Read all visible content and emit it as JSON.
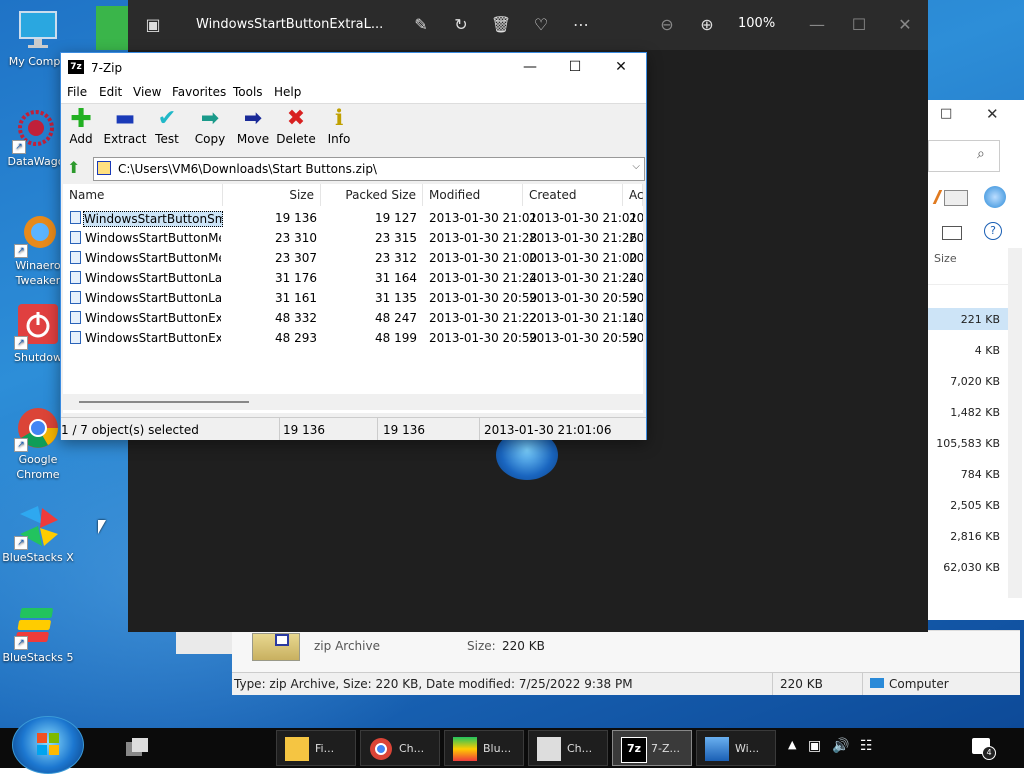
{
  "desktop_icons": [
    {
      "name": "my-computer",
      "label": "My Compu"
    },
    {
      "name": "datawagon",
      "label": "DataWago"
    },
    {
      "name": "winaero-tweaker",
      "label": "Winaero Tweaker"
    },
    {
      "name": "shutdown",
      "label": "Shutdow"
    },
    {
      "name": "google-chrome",
      "label": "Google Chrome"
    },
    {
      "name": "bluestacks-x",
      "label": "BlueStacks X"
    },
    {
      "name": "bluestacks-5",
      "label": "BlueStacks 5"
    }
  ],
  "photos": {
    "title": "WindowsStartButtonExtraL...",
    "zoom": "100%"
  },
  "explorer": {
    "size_header": "Size",
    "sizes": [
      "221 KB",
      "4 KB",
      "7,020 KB",
      "1,482 KB",
      "105,583 KB",
      "784 KB",
      "2,505 KB",
      "2,816 KB",
      "62,030 KB"
    ],
    "detail_type": "zip Archive",
    "detail_size_label": "Size:",
    "detail_size_value": "220 KB",
    "status_text": "Type: zip Archive, Size: 220 KB, Date modified: 7/25/2022 9:38 PM",
    "status_size": "220 KB",
    "status_location": "Computer"
  },
  "sevenzip": {
    "title": "7-Zip",
    "icon_text": "7z",
    "menu": [
      "File",
      "Edit",
      "View",
      "Favorites",
      "Tools",
      "Help"
    ],
    "toolbar": [
      "Add",
      "Extract",
      "Test",
      "Copy",
      "Move",
      "Delete",
      "Info"
    ],
    "address": "C:\\Users\\VM6\\Downloads\\Start Buttons.zip\\",
    "columns": [
      "Name",
      "Size",
      "Packed Size",
      "Modified",
      "Created",
      "Ac"
    ],
    "rows": [
      {
        "name": "WindowsStartButtonSm...",
        "size": "19 136",
        "packed": "19 127",
        "modified": "2013-01-30 21:01",
        "created": "2013-01-30 21:01",
        "ac": "20"
      },
      {
        "name": "WindowsStartButtonMe...",
        "size": "23 310",
        "packed": "23 315",
        "modified": "2013-01-30 21:28",
        "created": "2013-01-30 21:26",
        "ac": "20"
      },
      {
        "name": "WindowsStartButtonMe...",
        "size": "23 307",
        "packed": "23 312",
        "modified": "2013-01-30 21:00",
        "created": "2013-01-30 21:00",
        "ac": "20"
      },
      {
        "name": "WindowsStartButtonLar...",
        "size": "31 176",
        "packed": "31 164",
        "modified": "2013-01-30 21:24",
        "created": "2013-01-30 21:24",
        "ac": "20"
      },
      {
        "name": "WindowsStartButtonLar...",
        "size": "31 161",
        "packed": "31 135",
        "modified": "2013-01-30 20:59",
        "created": "2013-01-30 20:59",
        "ac": "20"
      },
      {
        "name": "WindowsStartButtonExt...",
        "size": "48 332",
        "packed": "48 247",
        "modified": "2013-01-30 21:22",
        "created": "2013-01-30 21:14",
        "ac": "20"
      },
      {
        "name": "WindowsStartButtonExt...",
        "size": "48 293",
        "packed": "48 199",
        "modified": "2013-01-30 20:59",
        "created": "2013-01-30 20:59",
        "ac": "20"
      }
    ],
    "status": {
      "selection": "1 / 7 object(s) selected",
      "size": "19 136",
      "packed": "19 136",
      "date": "2013-01-30 21:01:06"
    }
  },
  "taskbar": {
    "buttons": [
      "Fi...",
      "Ch...",
      "Blu...",
      "Ch...",
      "7-Z...",
      "Wi..."
    ],
    "notification_count": "4"
  }
}
